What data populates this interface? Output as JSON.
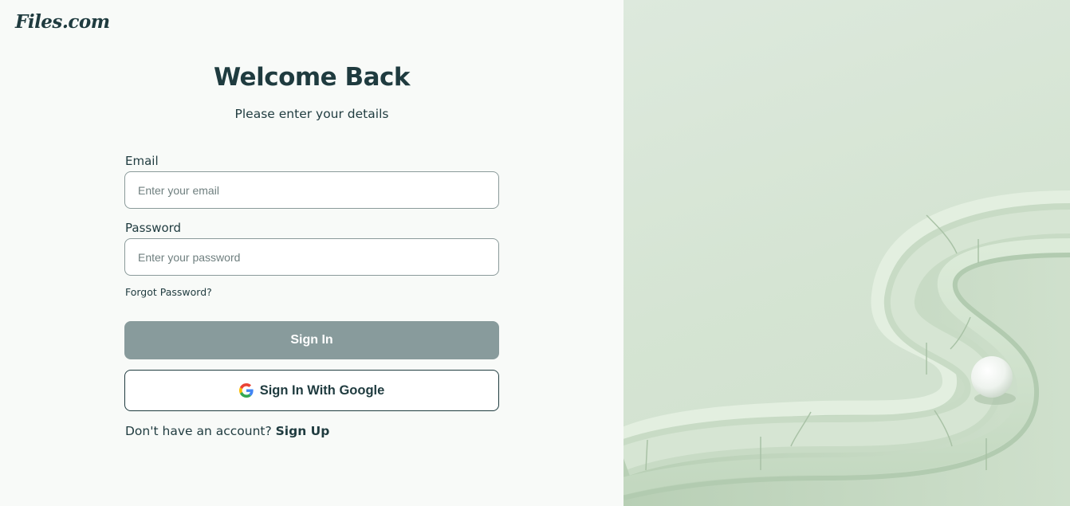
{
  "brand": {
    "logo": "Files.com"
  },
  "heading": {
    "title": "Welcome Back",
    "subtitle": "Please enter your details"
  },
  "form": {
    "email_label": "Email",
    "email_placeholder": "Enter your email",
    "email_value": "",
    "password_label": "Password",
    "password_placeholder": "Enter your password",
    "password_value": "",
    "forgot_label": "Forgot Password?",
    "signin_label": "Sign In",
    "google_label": "Sign In With Google",
    "signup_prompt": "Don't have an account? ",
    "signup_link": "Sign Up"
  },
  "icons": {
    "google": "google-g-icon"
  },
  "colors": {
    "primary_text": "#1f3b3f",
    "signin_button": "#889b9c",
    "background": "#f8faf8",
    "illustration_bg": "#d5e4d3"
  }
}
